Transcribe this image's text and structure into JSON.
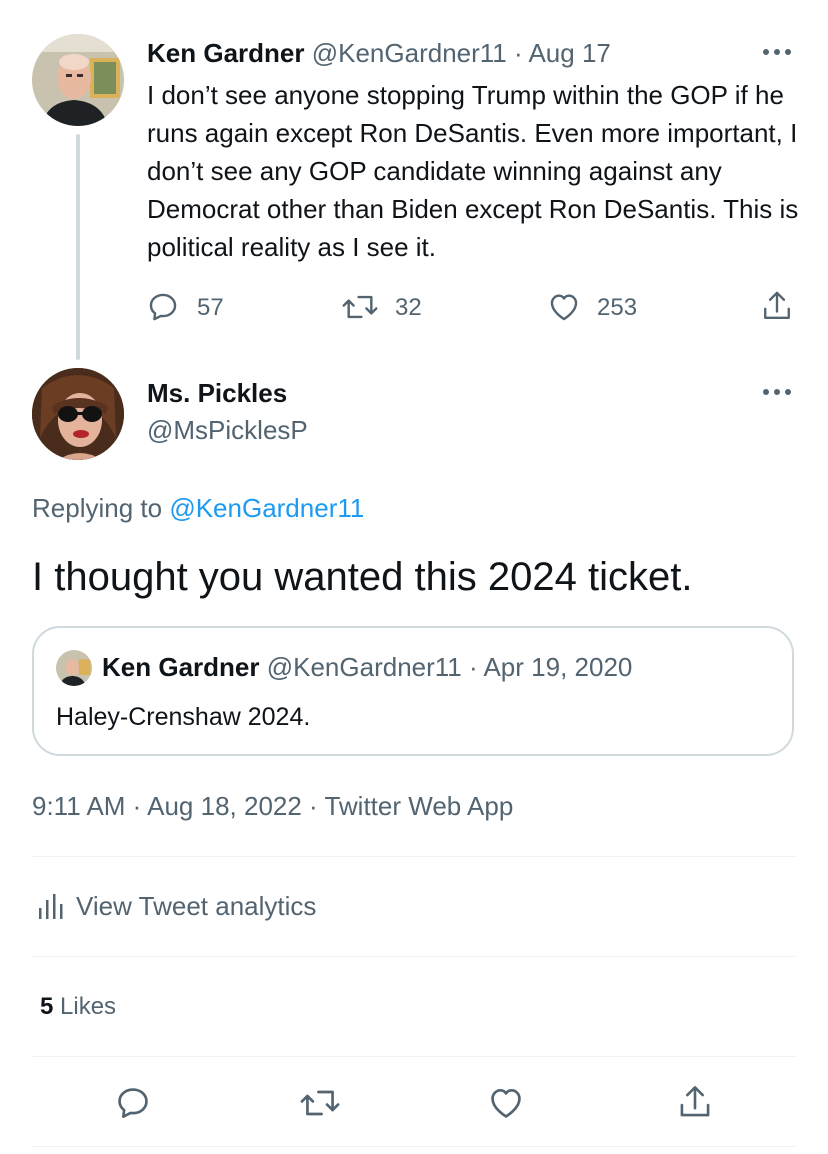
{
  "parent_tweet": {
    "author_name": "Ken Gardner",
    "handle": "@KenGardner11",
    "separator": "·",
    "date": "Aug 17",
    "text": "I don’t see anyone stopping Trump within the GOP if he runs again except Ron DeSantis. Even more important, I don’t see any GOP candidate winning against any Democrat other than Biden except Ron DeSantis.  This is political reality as I see it.",
    "replies": "57",
    "retweets": "32",
    "likes": "253",
    "more_icon": "more-horizontal-icon"
  },
  "main_tweet": {
    "author_name": "Ms. Pickles",
    "handle": "@MsPicklesP",
    "replying_prefix": "Replying to",
    "replying_handle": "@KenGardner11",
    "text": "I thought you wanted this 2024 ticket.",
    "timestamp": "9:11 AM · Aug 18, 2022 · Twitter Web App",
    "more_icon": "more-horizontal-icon"
  },
  "quoted_tweet": {
    "author_name": "Ken Gardner",
    "handle": "@KenGardner11",
    "separator": "·",
    "date": "Apr 19, 2020",
    "text": "Haley-Crenshaw 2024."
  },
  "analytics": {
    "label": "View Tweet analytics",
    "icon": "analytics-bars-icon"
  },
  "likes_summary": {
    "count": "5",
    "label": "Likes"
  },
  "action_bar": {
    "icons": [
      "reply-icon",
      "retweet-icon",
      "like-icon",
      "share-icon"
    ]
  },
  "colors": {
    "text_primary": "#0f1419",
    "text_secondary": "#536471",
    "link_blue": "#1d9bf0",
    "border": "#cfd9de",
    "divider": "#eff3f4"
  }
}
